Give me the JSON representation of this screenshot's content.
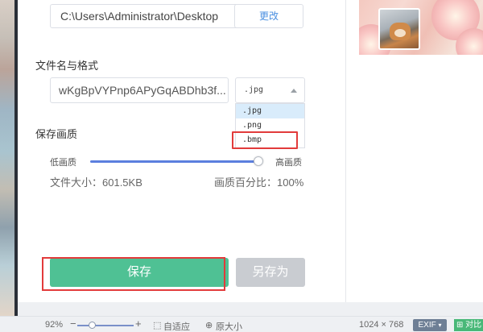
{
  "path": {
    "value": "C:\\Users\\Administrator\\Desktop",
    "change_label": "更改"
  },
  "filename_section": {
    "label": "文件名与格式",
    "name_value": "wKgBpVYPnp6APyGqABDhb3f...",
    "selected_format": ".jpg",
    "options": [
      ".jpg",
      ".png",
      ".bmp"
    ]
  },
  "quality_section": {
    "label": "保存画质",
    "low_label": "低画质",
    "high_label": "高画质",
    "level": 0.97,
    "file_size": "文件大小：601.5KB",
    "quality_percent": "画质百分比：100%"
  },
  "buttons": {
    "save": "保存",
    "save_as": "另存为"
  },
  "statusbar": {
    "zoom": "92%",
    "fit": "自适应",
    "original": "原大小",
    "dimensions": "1024 × 768",
    "exif": "EXIF",
    "compare": "对比"
  },
  "colors": {
    "primary": "#4fc194",
    "accent": "#4a8fe0",
    "highlight": "#e23b3b",
    "slider": "#5b7fde"
  }
}
